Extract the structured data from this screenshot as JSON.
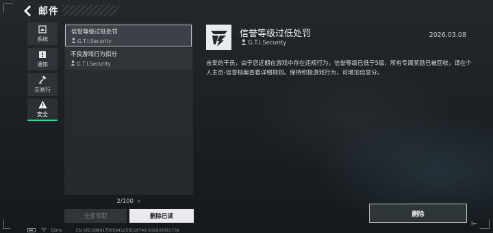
{
  "header": {
    "title": "邮件"
  },
  "sidebar": {
    "items": [
      {
        "label": "系统",
        "icon": "system-icon"
      },
      {
        "label": "通知",
        "icon": "notice-icon"
      },
      {
        "label": "交易行",
        "icon": "trade-icon"
      },
      {
        "label": "安全",
        "icon": "warning-icon",
        "active": true
      }
    ]
  },
  "mail_list": {
    "items": [
      {
        "title": "信誉等级过低处罚",
        "sender": "G.T.I.Security",
        "selected": true
      },
      {
        "title": "不良游戏行为扣分",
        "sender": "G.T.I.Security",
        "selected": false
      }
    ],
    "count": "2/100",
    "claim_all_label": "全部领取",
    "delete_read_label": "删除已读"
  },
  "detail": {
    "title": "信誉等级过低处罚",
    "sender": "G.T.I.Security",
    "date": "2026.03.08",
    "body": "亲爱的干员，由于您近期在游戏中存在违规行为，信誉等级已低于5级，所有专属奖励已被回收，请在个人主页-信誉档案查看详细规则。保持积极游戏行为，可增加信誉分。",
    "delete_label": "删除"
  },
  "status_bar": {
    "ping": "52ms",
    "id_text": "CN UID:188917005641250019749 202603081739"
  },
  "colors": {
    "accent_green": "#3bd48a",
    "background": "#1c2024"
  }
}
